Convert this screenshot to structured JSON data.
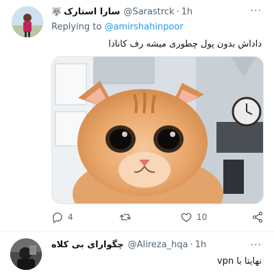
{
  "tweet": {
    "display_name": "سارا استارک",
    "name_emoji": "🐺",
    "handle": "@Sarastrck",
    "time": "1h",
    "reply_prefix": "Replying to ",
    "reply_to": "@amirshahinpoor",
    "text": "داداش بدون پول چطوری میشه رف کانادا",
    "media_alt": "orange cat staring at camera",
    "stats": {
      "replies": "4",
      "retweets": "",
      "likes": "10"
    }
  },
  "reply": {
    "display_name": "چگوارای بی کلاه",
    "handle": "@Alireza_hqa",
    "time": "1h",
    "text": "نهایتا با vpn"
  },
  "ui": {
    "more": "···",
    "dot": "·"
  },
  "colors": {
    "accent": "#1d9bf0",
    "muted": "#536471",
    "text": "#0f1419"
  }
}
